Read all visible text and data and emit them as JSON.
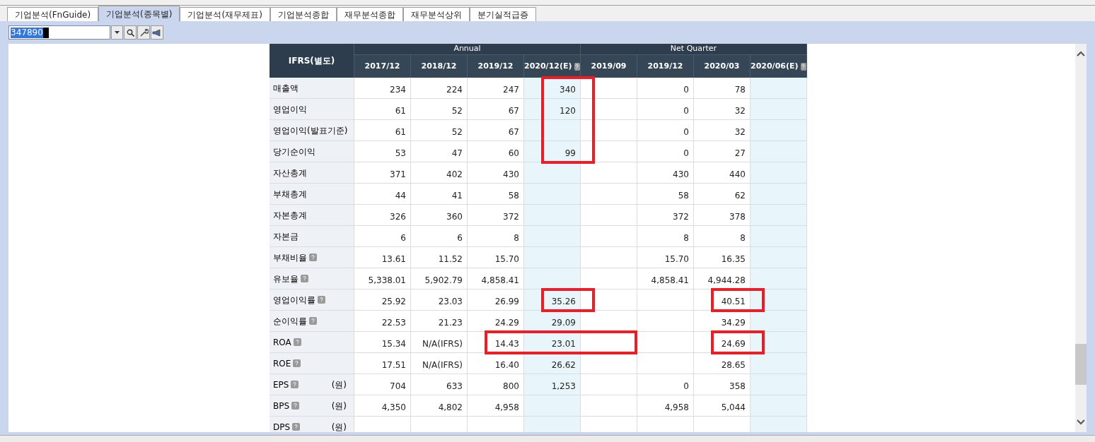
{
  "tabs": [
    {
      "label": "기업분석(FnGuide)",
      "selected": false
    },
    {
      "label": "기업분석(종목별)",
      "selected": true
    },
    {
      "label": "기업분석(재무제표)",
      "selected": false
    },
    {
      "label": "기업분석종합",
      "selected": false
    },
    {
      "label": "재무분석종합",
      "selected": false
    },
    {
      "label": "재무분석상위",
      "selected": false
    },
    {
      "label": "분기실적급증",
      "selected": false
    }
  ],
  "code_field": {
    "value": "347890"
  },
  "table": {
    "corner": "IFRS(별도)",
    "groups": [
      {
        "label": "Annual",
        "columns": [
          {
            "label": "2017/12",
            "estimate": false
          },
          {
            "label": "2018/12",
            "estimate": false
          },
          {
            "label": "2019/12",
            "estimate": false
          },
          {
            "label": "2020/12(E)",
            "estimate": true
          }
        ]
      },
      {
        "label": "Net Quarter",
        "columns": [
          {
            "label": "2019/09",
            "estimate": false
          },
          {
            "label": "2019/12",
            "estimate": false
          },
          {
            "label": "2020/03",
            "estimate": false
          },
          {
            "label": "2020/06(E)",
            "estimate": true
          }
        ]
      }
    ],
    "rows": [
      {
        "label": "매출액",
        "help": false,
        "cells": [
          {
            "text": "234",
            "boxed": false
          },
          {
            "text": "224",
            "boxed": false
          },
          {
            "text": "247",
            "boxed": false
          },
          {
            "text": "340",
            "boxed": true
          },
          {
            "boxed": false
          },
          {
            "text": "0",
            "boxed": false
          },
          {
            "text": "78",
            "boxed": false
          },
          {
            "boxed": false
          }
        ]
      },
      {
        "label": "영업이익",
        "help": false,
        "cells": [
          {
            "text": "61",
            "boxed": false
          },
          {
            "text": "52",
            "boxed": false
          },
          {
            "text": "67",
            "boxed": false
          },
          {
            "text": "120",
            "boxed": true
          },
          {
            "boxed": false
          },
          {
            "text": "0",
            "boxed": false
          },
          {
            "text": "32",
            "boxed": false
          },
          {
            "boxed": false
          }
        ]
      },
      {
        "label": "영업이익(발표기준)",
        "help": false,
        "cells": [
          {
            "text": "61",
            "boxed": false
          },
          {
            "text": "52",
            "boxed": false
          },
          {
            "text": "67",
            "boxed": false
          },
          {
            "boxed": true
          },
          {
            "boxed": false
          },
          {
            "text": "0",
            "boxed": false
          },
          {
            "text": "32",
            "boxed": false
          },
          {
            "boxed": false
          }
        ]
      },
      {
        "label": "당기순이익",
        "help": false,
        "cells": [
          {
            "text": "53",
            "boxed": false
          },
          {
            "text": "47",
            "boxed": false
          },
          {
            "text": "60",
            "boxed": false
          },
          {
            "text": "99",
            "boxed": true
          },
          {
            "boxed": false
          },
          {
            "text": "0",
            "boxed": false
          },
          {
            "text": "27",
            "boxed": false
          },
          {
            "boxed": false
          }
        ]
      },
      {
        "label": "자산총계",
        "help": false,
        "cells": [
          {
            "text": "371",
            "boxed": false
          },
          {
            "text": "402",
            "boxed": false
          },
          {
            "text": "430",
            "boxed": false
          },
          {
            "boxed": false
          },
          {
            "boxed": false
          },
          {
            "text": "430",
            "boxed": false
          },
          {
            "text": "440",
            "boxed": false
          },
          {
            "boxed": false
          }
        ]
      },
      {
        "label": "부채총계",
        "help": false,
        "cells": [
          {
            "text": "44",
            "boxed": false
          },
          {
            "text": "41",
            "boxed": false
          },
          {
            "text": "58",
            "boxed": false
          },
          {
            "boxed": false
          },
          {
            "boxed": false
          },
          {
            "text": "58",
            "boxed": false
          },
          {
            "text": "62",
            "boxed": false
          },
          {
            "boxed": false
          }
        ]
      },
      {
        "label": "자본총계",
        "help": false,
        "cells": [
          {
            "text": "326",
            "boxed": false
          },
          {
            "text": "360",
            "boxed": false
          },
          {
            "text": "372",
            "boxed": false
          },
          {
            "boxed": false
          },
          {
            "boxed": false
          },
          {
            "text": "372",
            "boxed": false
          },
          {
            "text": "378",
            "boxed": false
          },
          {
            "boxed": false
          }
        ]
      },
      {
        "label": "자본금",
        "help": false,
        "cells": [
          {
            "text": "6",
            "boxed": false
          },
          {
            "text": "6",
            "boxed": false
          },
          {
            "text": "8",
            "boxed": false
          },
          {
            "boxed": false
          },
          {
            "boxed": false
          },
          {
            "text": "8",
            "boxed": false
          },
          {
            "text": "8",
            "boxed": false
          },
          {
            "boxed": false
          }
        ]
      },
      {
        "label": "부채비율",
        "help": true,
        "cells": [
          {
            "text": "13.61",
            "boxed": false
          },
          {
            "text": "11.52",
            "boxed": false
          },
          {
            "text": "15.70",
            "boxed": false
          },
          {
            "boxed": false
          },
          {
            "boxed": false
          },
          {
            "text": "15.70",
            "boxed": false
          },
          {
            "text": "16.35",
            "boxed": false
          },
          {
            "boxed": false
          }
        ]
      },
      {
        "label": "유보율",
        "help": true,
        "cells": [
          {
            "text": "5,338.01",
            "boxed": false
          },
          {
            "text": "5,902.79",
            "boxed": false
          },
          {
            "text": "4,858.41",
            "boxed": false
          },
          {
            "boxed": false
          },
          {
            "boxed": false
          },
          {
            "text": "4,858.41",
            "boxed": false
          },
          {
            "text": "4,944.28",
            "boxed": false
          },
          {
            "boxed": false
          }
        ]
      },
      {
        "label": "영업이익률",
        "help": true,
        "cells": [
          {
            "text": "25.92",
            "boxed": false
          },
          {
            "text": "23.03",
            "boxed": false
          },
          {
            "text": "26.99",
            "boxed": false
          },
          {
            "text": "35.26",
            "boxed": true
          },
          {
            "boxed": false
          },
          {
            "boxed": false
          },
          {
            "text": "40.51",
            "boxed": true
          },
          {
            "boxed": false
          }
        ]
      },
      {
        "label": "순이익률",
        "help": true,
        "cells": [
          {
            "text": "22.53",
            "boxed": false
          },
          {
            "text": "21.23",
            "boxed": false
          },
          {
            "text": "24.29",
            "boxed": false
          },
          {
            "text": "29.09",
            "boxed": false
          },
          {
            "boxed": false
          },
          {
            "boxed": false
          },
          {
            "text": "34.29",
            "boxed": false
          },
          {
            "boxed": false
          }
        ]
      },
      {
        "label": "ROA",
        "help": true,
        "cells": [
          {
            "text": "15.34",
            "boxed": false
          },
          {
            "text": "N/A(IFRS)",
            "boxed": false
          },
          {
            "text": "14.43",
            "boxed": true
          },
          {
            "text": "23.01",
            "boxed": true
          },
          {
            "boxed": true
          },
          {
            "boxed": false
          },
          {
            "text": "24.69",
            "boxed": true
          },
          {
            "boxed": false
          }
        ]
      },
      {
        "label": "ROE",
        "help": true,
        "cells": [
          {
            "text": "17.51",
            "boxed": false
          },
          {
            "text": "N/A(IFRS)",
            "boxed": false
          },
          {
            "text": "16.40",
            "boxed": false
          },
          {
            "text": "26.62",
            "boxed": false
          },
          {
            "boxed": false
          },
          {
            "boxed": false
          },
          {
            "text": "28.65",
            "boxed": false
          },
          {
            "boxed": false
          }
        ]
      },
      {
        "label": "EPS",
        "help": true,
        "unit": "(원)",
        "cells": [
          {
            "text": "704",
            "boxed": false
          },
          {
            "text": "633",
            "boxed": false
          },
          {
            "text": "800",
            "boxed": false
          },
          {
            "text": "1,253",
            "boxed": false
          },
          {
            "boxed": false
          },
          {
            "text": "0",
            "boxed": false
          },
          {
            "text": "358",
            "boxed": false
          },
          {
            "boxed": false
          }
        ]
      },
      {
        "label": "BPS",
        "help": true,
        "unit": "(원)",
        "cells": [
          {
            "text": "4,350",
            "boxed": false
          },
          {
            "text": "4,802",
            "boxed": false
          },
          {
            "text": "4,958",
            "boxed": false
          },
          {
            "boxed": false
          },
          {
            "boxed": false
          },
          {
            "text": "4,958",
            "boxed": false
          },
          {
            "text": "5,044",
            "boxed": false
          },
          {
            "boxed": false
          }
        ]
      },
      {
        "label": "DPS",
        "help": true,
        "unit": "(원)",
        "cells": [
          {
            "boxed": false
          },
          {
            "boxed": false
          },
          {
            "boxed": false
          },
          {
            "boxed": false
          },
          {
            "boxed": false
          },
          {
            "boxed": false
          },
          {
            "boxed": false
          },
          {
            "boxed": false
          }
        ]
      }
    ]
  }
}
